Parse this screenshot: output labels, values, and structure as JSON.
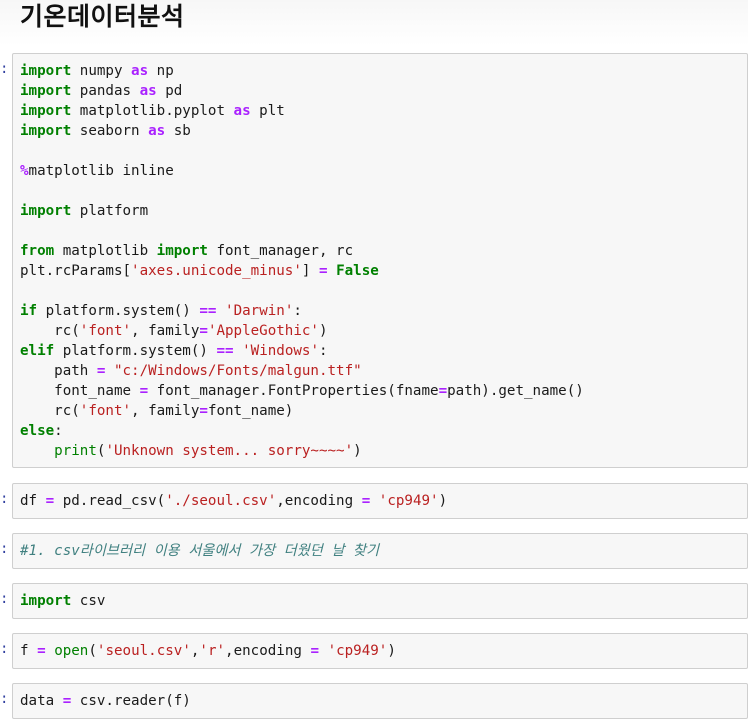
{
  "notebook": {
    "heading": "기온데이터분석",
    "prompt_symbol": ":",
    "cells": [
      {
        "lines": [
          [
            [
              "kw",
              "import"
            ],
            [
              "t",
              " numpy "
            ],
            [
              "op",
              "as"
            ],
            [
              "t",
              " np"
            ]
          ],
          [
            [
              "kw",
              "import"
            ],
            [
              "t",
              " pandas "
            ],
            [
              "op",
              "as"
            ],
            [
              "t",
              " pd"
            ]
          ],
          [
            [
              "kw",
              "import"
            ],
            [
              "t",
              " matplotlib.pyplot "
            ],
            [
              "op",
              "as"
            ],
            [
              "t",
              " plt"
            ]
          ],
          [
            [
              "kw",
              "import"
            ],
            [
              "t",
              " seaborn "
            ],
            [
              "op",
              "as"
            ],
            [
              "t",
              " sb"
            ]
          ],
          [],
          [
            [
              "mag",
              "%"
            ],
            [
              "t",
              "matplotlib inline"
            ]
          ],
          [],
          [
            [
              "kw",
              "import"
            ],
            [
              "t",
              " platform"
            ]
          ],
          [],
          [
            [
              "kw",
              "from"
            ],
            [
              "t",
              " matplotlib "
            ],
            [
              "kw",
              "import"
            ],
            [
              "t",
              " font_manager, rc"
            ]
          ],
          [
            [
              "t",
              "plt.rcParams["
            ],
            [
              "str",
              "'axes.unicode_minus'"
            ],
            [
              "t",
              "] "
            ],
            [
              "op",
              "="
            ],
            [
              "t",
              " "
            ],
            [
              "kw",
              "False"
            ]
          ],
          [],
          [
            [
              "kw",
              "if"
            ],
            [
              "t",
              " platform.system() "
            ],
            [
              "op",
              "=="
            ],
            [
              "t",
              " "
            ],
            [
              "str",
              "'Darwin'"
            ],
            [
              "t",
              ":"
            ]
          ],
          [
            [
              "t",
              "    rc("
            ],
            [
              "str",
              "'font'"
            ],
            [
              "t",
              ", family"
            ],
            [
              "op",
              "="
            ],
            [
              "str",
              "'AppleGothic'"
            ],
            [
              "t",
              ")"
            ]
          ],
          [
            [
              "kw",
              "elif"
            ],
            [
              "t",
              " platform.system() "
            ],
            [
              "op",
              "=="
            ],
            [
              "t",
              " "
            ],
            [
              "str",
              "'Windows'"
            ],
            [
              "t",
              ":"
            ]
          ],
          [
            [
              "t",
              "    path "
            ],
            [
              "op",
              "="
            ],
            [
              "t",
              " "
            ],
            [
              "str",
              "\"c:/Windows/Fonts/malgun.ttf\""
            ]
          ],
          [
            [
              "t",
              "    font_name "
            ],
            [
              "op",
              "="
            ],
            [
              "t",
              " font_manager.FontProperties(fname"
            ],
            [
              "op",
              "="
            ],
            [
              "t",
              "path).get_name()"
            ]
          ],
          [
            [
              "t",
              "    rc("
            ],
            [
              "str",
              "'font'"
            ],
            [
              "t",
              ", family"
            ],
            [
              "op",
              "="
            ],
            [
              "t",
              "font_name)"
            ]
          ],
          [
            [
              "kw",
              "else"
            ],
            [
              "t",
              ":"
            ]
          ],
          [
            [
              "t",
              "    "
            ],
            [
              "bi",
              "print"
            ],
            [
              "t",
              "("
            ],
            [
              "str",
              "'Unknown system... sorry~~~~'"
            ],
            [
              "t",
              ")"
            ]
          ]
        ]
      },
      {
        "lines": [
          [
            [
              "t",
              "df "
            ],
            [
              "op",
              "="
            ],
            [
              "t",
              " pd.read_csv("
            ],
            [
              "str",
              "'./seoul.csv'"
            ],
            [
              "t",
              ",encoding "
            ],
            [
              "op",
              "="
            ],
            [
              "t",
              " "
            ],
            [
              "str",
              "'cp949'"
            ],
            [
              "t",
              ")"
            ]
          ]
        ]
      },
      {
        "lines": [
          [
            [
              "cmt",
              "#1. csv라이브러리 이용 서울에서 가장 더웠던 날 찾기"
            ]
          ]
        ]
      },
      {
        "lines": [
          [
            [
              "kw",
              "import"
            ],
            [
              "t",
              " csv"
            ]
          ]
        ]
      },
      {
        "lines": [
          [
            [
              "t",
              "f "
            ],
            [
              "op",
              "="
            ],
            [
              "t",
              " "
            ],
            [
              "bi",
              "open"
            ],
            [
              "t",
              "("
            ],
            [
              "str",
              "'seoul.csv'"
            ],
            [
              "t",
              ","
            ],
            [
              "str",
              "'r'"
            ],
            [
              "t",
              ",encoding "
            ],
            [
              "op",
              "="
            ],
            [
              "t",
              " "
            ],
            [
              "str",
              "'cp949'"
            ],
            [
              "t",
              ")"
            ]
          ]
        ]
      },
      {
        "lines": [
          [
            [
              "t",
              "data "
            ],
            [
              "op",
              "="
            ],
            [
              "t",
              " csv.reader(f)"
            ]
          ]
        ]
      }
    ]
  }
}
